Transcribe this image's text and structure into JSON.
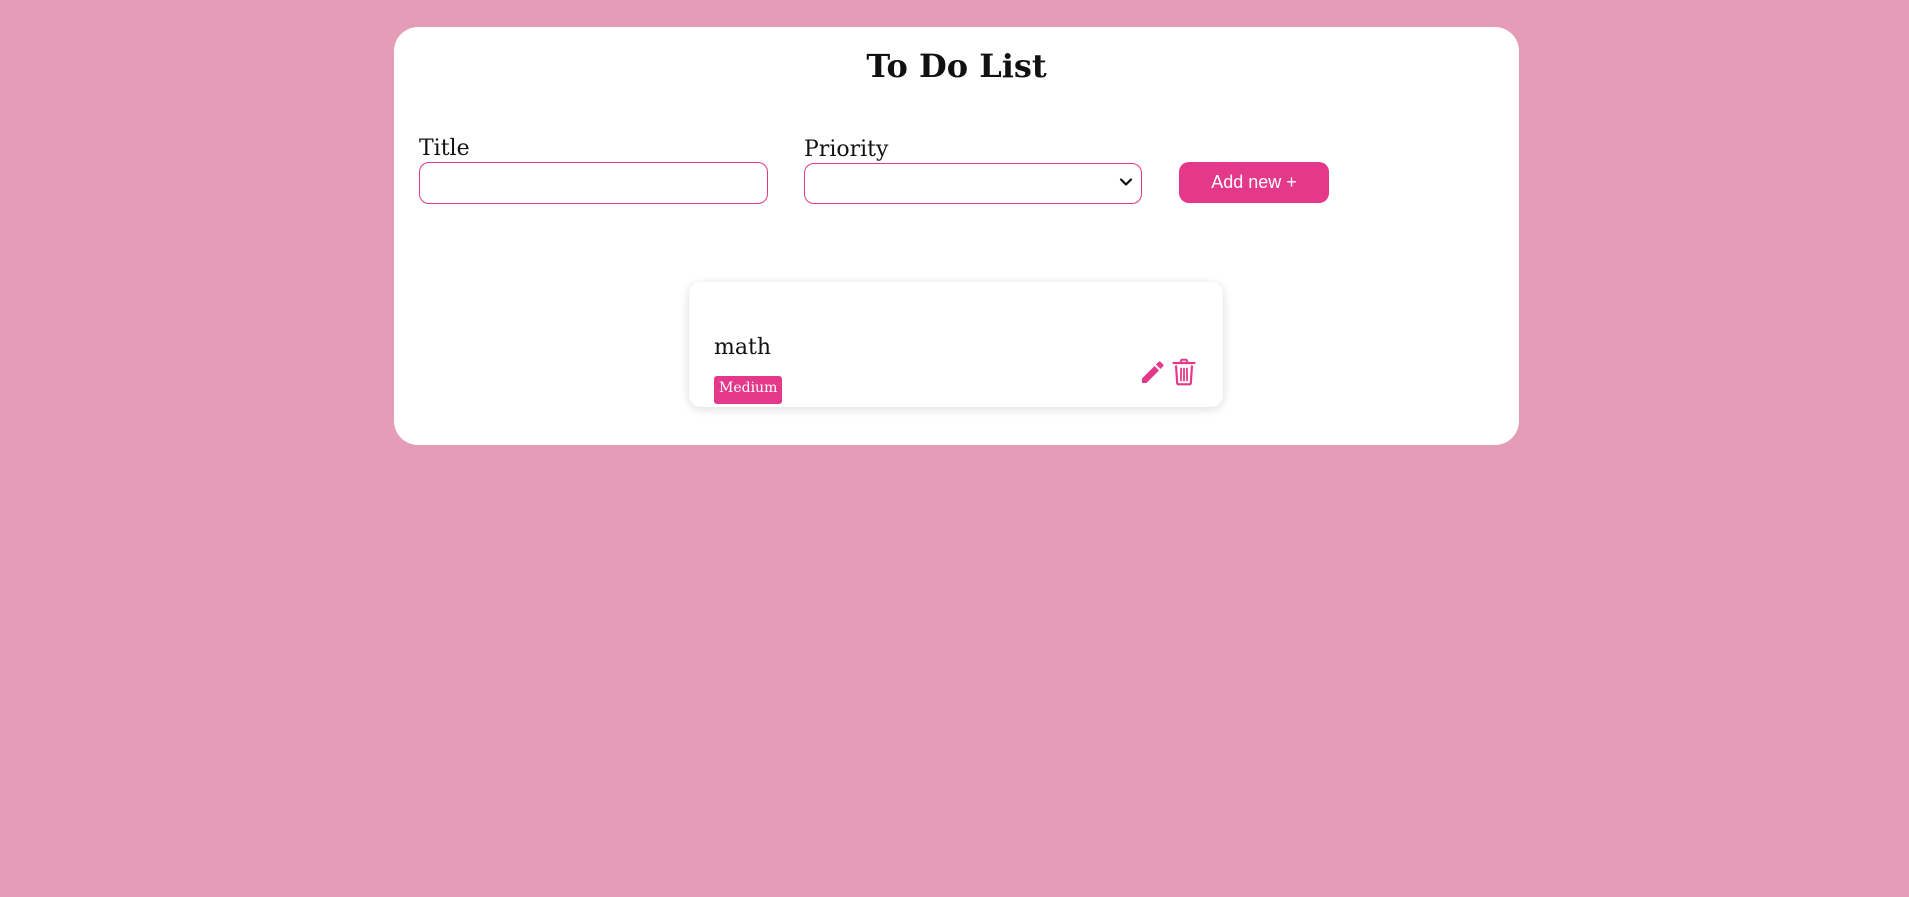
{
  "header": {
    "title": "To Do List"
  },
  "form": {
    "title_label": "Title",
    "title_value": "",
    "title_placeholder": "",
    "priority_label": "Priority",
    "priority_selected": "",
    "add_button_label": "Add new +"
  },
  "tasks": [
    {
      "title": "math",
      "priority": "Medium",
      "edit_icon": "pencil-icon",
      "delete_icon": "trash-icon"
    }
  ],
  "colors": {
    "background": "#e59cb6",
    "card": "#ffffff",
    "accent": "#e4398a",
    "text": "#111111"
  }
}
